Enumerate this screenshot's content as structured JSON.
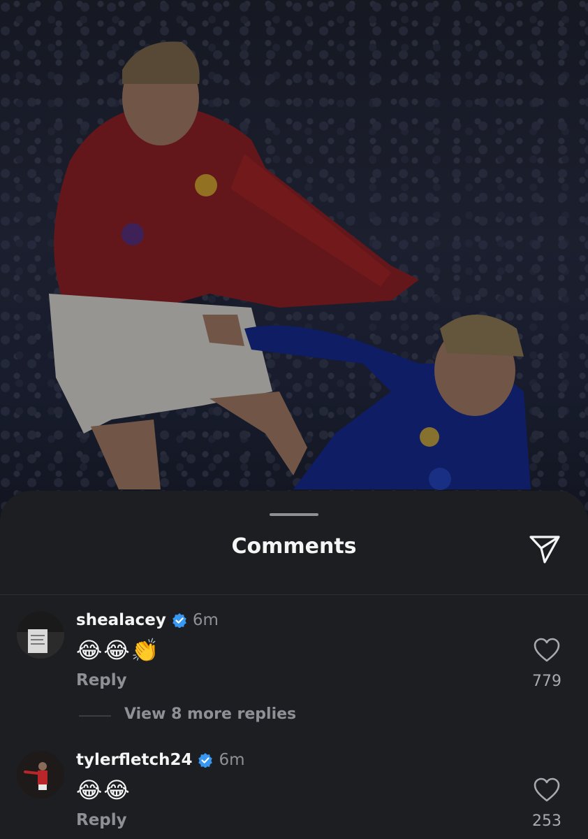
{
  "photo": {
    "description_icon": "football-match-image"
  },
  "sheet": {
    "title": "Comments",
    "share_icon": "paper-plane-icon"
  },
  "comments": [
    {
      "username": "shealacey",
      "verified": true,
      "time": "6m",
      "text": "😂😂👏",
      "reply_label": "Reply",
      "likes": "779",
      "view_replies": "View 8 more replies"
    },
    {
      "username": "tylerfletch24",
      "verified": true,
      "time": "6m",
      "text": "😂😂",
      "reply_label": "Reply",
      "likes": "253"
    }
  ],
  "colors": {
    "background": "#1c1e21",
    "verified_blue": "#3897f0",
    "muted_text": "#8e9096"
  }
}
